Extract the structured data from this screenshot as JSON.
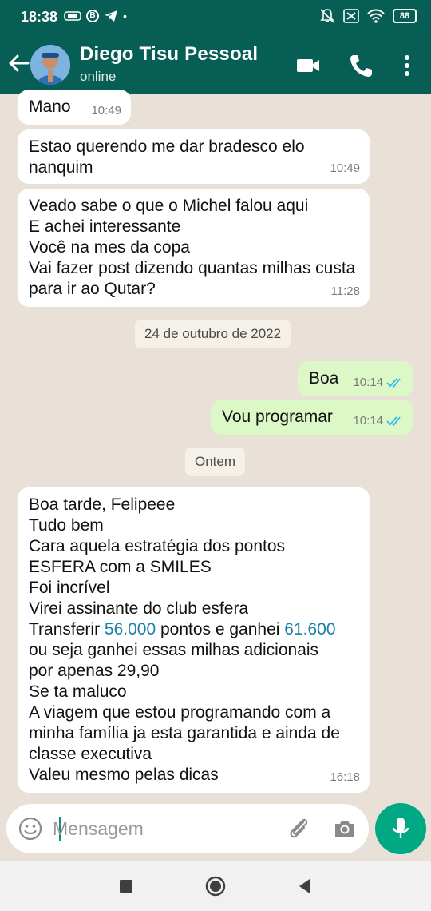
{
  "status_bar": {
    "time": "18:38",
    "battery": "88"
  },
  "header": {
    "contact_name": "Diego Tisu Pessoal",
    "contact_status": "online"
  },
  "messages": [
    {
      "dir": "in",
      "text": "Mano",
      "time": "10:49"
    },
    {
      "dir": "in",
      "text": "Estao querendo me dar bradesco elo nanquim",
      "time": "10:49"
    },
    {
      "dir": "in",
      "text": "Veado sabe o que o Michel falou aqui\nE achei interessante\nVocê na mes da copa\nVai fazer post dizendo quantas milhas custa para ir ao Qutar?",
      "time": "11:28"
    },
    {
      "dir": "date",
      "text": "24 de outubro de 2022"
    },
    {
      "dir": "out",
      "text": "Boa",
      "time": "10:14",
      "status": "read"
    },
    {
      "dir": "out",
      "text": "Vou programar",
      "time": "10:14",
      "status": "read"
    },
    {
      "dir": "date",
      "text": "Ontem"
    },
    {
      "dir": "in",
      "text_parts": [
        "Boa tarde, Felipeee\nTudo bem\nCara aquela estratégia dos pontos\nESFERA com a SMILES\nFoi incrível\nVirei assinante do club esfera\nTransferir ",
        "56.000",
        " pontos e ganhei ",
        "61.600",
        "\nou seja ganhei essas milhas adicionais\npor apenas 29,90\nSe ta maluco\nA viagem que estou programando com a\nminha família ja esta garantida e ainda de\nclasse executiva\nValeu mesmo pelas dicas"
      ],
      "time": "16:18"
    }
  ],
  "composer": {
    "placeholder": "Mensagem"
  },
  "colors": {
    "header": "#075e54",
    "chat_bg": "#e9e1d7",
    "outgoing": "#dcf8c6",
    "incoming": "#ffffff",
    "accent": "#00a884",
    "read_ticks": "#34b7f1",
    "number_highlight": "#1b7fa8"
  }
}
